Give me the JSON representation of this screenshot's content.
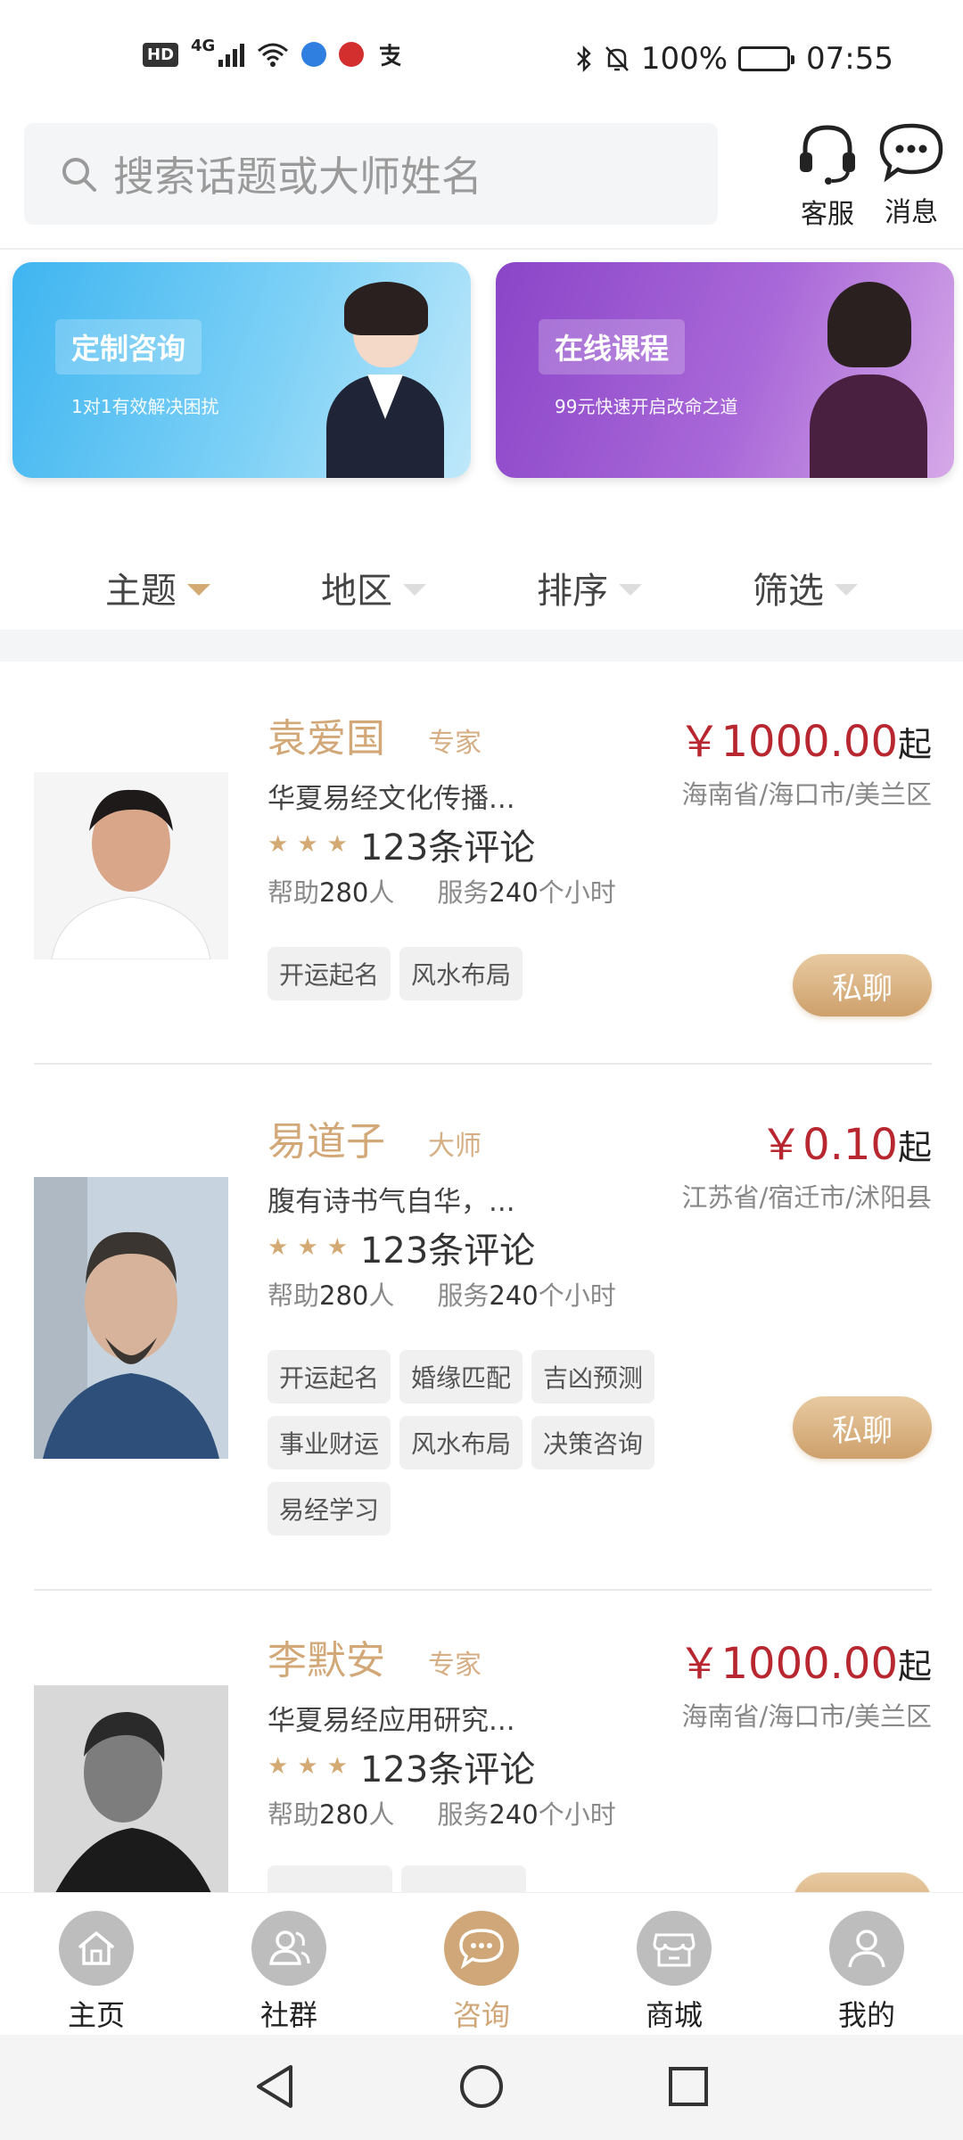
{
  "status_bar": {
    "left": {
      "hd": "HD",
      "network": "4G"
    },
    "right": {
      "battery": "100%",
      "time": "07:55"
    },
    "icons": [
      "hd-icon",
      "signal-icon",
      "wifi-icon",
      "browser-icon",
      "metro-icon",
      "alipay-icon",
      "bluetooth-icon",
      "mute-icon",
      "battery-icon"
    ]
  },
  "header": {
    "search_placeholder": "搜索话题或大师姓名",
    "service_label": "客服",
    "message_label": "消息"
  },
  "banners": [
    {
      "title": "定制咨询",
      "subtitle": "1对1有效解决困扰",
      "color": "#4ab9f1"
    },
    {
      "title": "在线课程",
      "subtitle": "99元快速开启改命之道",
      "color": "#9450cc"
    }
  ],
  "filters": [
    {
      "label": "主题",
      "active": true
    },
    {
      "label": "地区",
      "active": false
    },
    {
      "label": "排序",
      "active": false
    },
    {
      "label": "筛选",
      "active": false
    }
  ],
  "masters": [
    {
      "name": "袁爱国",
      "rank": "专家",
      "price": "￥1000.00",
      "price_suffix": "起",
      "location": "海南省/海口市/美兰区",
      "description": "华夏易经文化传播...",
      "rating": 3,
      "reviews": "123条评论",
      "help_label": "帮助",
      "help_count": "280",
      "help_unit": "人",
      "service_label": "服务",
      "service_hours": "240",
      "service_unit": "个小时",
      "tags": [
        "开运起名",
        "风水布局"
      ],
      "chat_label": "私聊"
    },
    {
      "name": "易道子",
      "rank": "大师",
      "price": "￥0.10",
      "price_suffix": "起",
      "location": "江苏省/宿迁市/沭阳县",
      "description": "腹有诗书气自华，...",
      "rating": 3,
      "reviews": "123条评论",
      "help_label": "帮助",
      "help_count": "280",
      "help_unit": "人",
      "service_label": "服务",
      "service_hours": "240",
      "service_unit": "个小时",
      "tags": [
        "开运起名",
        "婚缘匹配",
        "吉凶预测",
        "事业财运",
        "风水布局",
        "决策咨询",
        "易经学习"
      ],
      "chat_label": "私聊"
    },
    {
      "name": "李默安",
      "rank": "专家",
      "price": "￥1000.00",
      "price_suffix": "起",
      "location": "海南省/海口市/美兰区",
      "description": "华夏易经应用研究...",
      "rating": 3,
      "reviews": "123条评论",
      "help_label": "帮助",
      "help_count": "280",
      "help_unit": "人",
      "service_label": "服务",
      "service_hours": "240",
      "service_unit": "个小时",
      "tags": [],
      "chat_label": ""
    }
  ],
  "tab_bar": [
    {
      "label": "主页",
      "icon": "home-icon",
      "active": false
    },
    {
      "label": "社群",
      "icon": "community-icon",
      "active": false
    },
    {
      "label": "咨询",
      "icon": "consult-icon",
      "active": true
    },
    {
      "label": "商城",
      "icon": "shop-icon",
      "active": false
    },
    {
      "label": "我的",
      "icon": "profile-icon",
      "active": false
    }
  ],
  "system_nav": [
    "back-icon",
    "home-circle-icon",
    "recents-icon"
  ],
  "colors": {
    "accent_gold": "#d3a878",
    "price_red": "#b8262f",
    "chat_gradient_top": "#e8caa1",
    "chat_gradient_bottom": "#cea06b"
  }
}
